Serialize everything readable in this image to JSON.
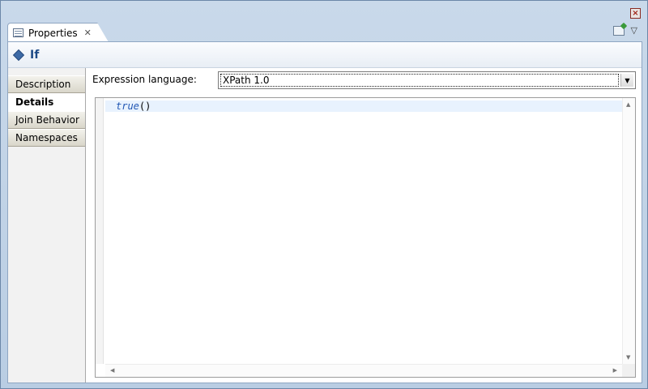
{
  "window": {
    "close_glyph": "×"
  },
  "view": {
    "tab_label": "Properties",
    "tab_close_glyph": "✕",
    "menu_glyph": "▽"
  },
  "header": {
    "title": "If"
  },
  "sidebar": {
    "items": [
      {
        "label": "Description",
        "active": false
      },
      {
        "label": "Details",
        "active": true
      },
      {
        "label": "Join Behavior",
        "active": false
      },
      {
        "label": "Namespaces",
        "active": false
      }
    ]
  },
  "details": {
    "expression_language_label": "Expression language:",
    "expression_language_value": "XPath 1.0",
    "code": {
      "keyword": "true",
      "suffix": "()"
    }
  },
  "colors": {
    "keyword": "#1f55b3",
    "header_title": "#1d4a86",
    "current_line": "#e8f2fe"
  }
}
